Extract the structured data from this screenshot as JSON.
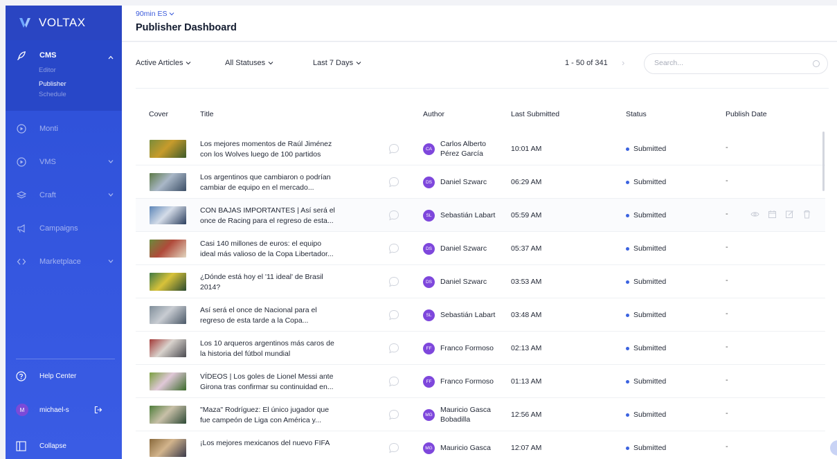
{
  "brand": {
    "name": "VOLTAX"
  },
  "sidebar": {
    "cms": {
      "label": "CMS",
      "items": [
        "Editor",
        "Publisher",
        "Schedule"
      ],
      "active": "Publisher"
    },
    "sections": [
      {
        "label": "Monti",
        "icon": "play-circle-icon"
      },
      {
        "label": "VMS",
        "icon": "play-circle-icon"
      },
      {
        "label": "Craft",
        "icon": "layers-icon"
      },
      {
        "label": "Campaigns",
        "icon": "megaphone-icon"
      },
      {
        "label": "Marketplace",
        "icon": "code-brackets-icon"
      }
    ],
    "help": "Help Center",
    "user": {
      "initial": "M",
      "name": "michael-s"
    },
    "collapse": "Collapse"
  },
  "header": {
    "site": "90min ES",
    "title": "Publisher Dashboard"
  },
  "filters": {
    "articles": "Active Articles",
    "statuses": "All Statuses",
    "range": "Last 7 Days",
    "pager": "1 - 50 of 341",
    "search_placeholder": "Search..."
  },
  "table": {
    "headers": {
      "cover": "Cover",
      "title": "Title",
      "author": "Author",
      "submitted": "Last Submitted",
      "status": "Status",
      "publish": "Publish Date"
    },
    "rows": [
      {
        "title1": "Los mejores momentos de Raúl Jiménez",
        "title2": "con los Wolves luego de 100 partidos",
        "initials": "CA",
        "author1": "Carlos Alberto",
        "author2": "Pérez García",
        "time": "10:01 AM",
        "status": "Submitted",
        "publish": "-"
      },
      {
        "title1": "Los argentinos que cambiaron o podrían",
        "title2": "cambiar de equipo en el mercado...",
        "initials": "DS",
        "author1": "Daniel Szwarc",
        "author2": "",
        "time": "06:29 AM",
        "status": "Submitted",
        "publish": "-"
      },
      {
        "title1": "CON BAJAS IMPORTANTES | Así será el",
        "title2": "once de Racing para el regreso de esta...",
        "initials": "SL",
        "author1": "Sebastián Labart",
        "author2": "",
        "time": "05:59 AM",
        "status": "Submitted",
        "publish": "-"
      },
      {
        "title1": "Casi 140 millones de euros: el equipo",
        "title2": "ideal más valioso de la Copa Libertador...",
        "initials": "DS",
        "author1": "Daniel Szwarc",
        "author2": "",
        "time": "05:37 AM",
        "status": "Submitted",
        "publish": "-"
      },
      {
        "title1": "¿Dónde está hoy el '11 ideal' de Brasil",
        "title2": "2014?",
        "initials": "DS",
        "author1": "Daniel Szwarc",
        "author2": "",
        "time": "03:53 AM",
        "status": "Submitted",
        "publish": "-"
      },
      {
        "title1": "Así será el once de Nacional para el",
        "title2": "regreso de esta tarde a la Copa...",
        "initials": "SL",
        "author1": "Sebastián Labart",
        "author2": "",
        "time": "03:48 AM",
        "status": "Submitted",
        "publish": "-"
      },
      {
        "title1": "Los 10 arqueros argentinos más caros de",
        "title2": "la historia del fútbol mundial",
        "initials": "FF",
        "author1": "Franco Formoso",
        "author2": "",
        "time": "02:13 AM",
        "status": "Submitted",
        "publish": "-"
      },
      {
        "title1": "VÍDEOS | Los goles de Lionel Messi ante",
        "title2": "Girona tras confirmar su continuidad en...",
        "initials": "FF",
        "author1": "Franco Formoso",
        "author2": "",
        "time": "01:13 AM",
        "status": "Submitted",
        "publish": "-"
      },
      {
        "title1": "\"Maza\" Rodríguez: El único jugador que",
        "title2": "fue campeón de Liga con América y...",
        "initials": "MG",
        "author1": "Mauricio Gasca",
        "author2": "Bobadilla",
        "time": "12:56 AM",
        "status": "Submitted",
        "publish": "-"
      },
      {
        "title1": "¡Los mejores mexicanos del nuevo FIFA",
        "title2": "",
        "initials": "MG",
        "author1": "Mauricio Gasca",
        "author2": "",
        "time": "12:07 AM",
        "status": "Submitted",
        "publish": "-"
      }
    ]
  },
  "colors": {
    "sidebar": "#3557e0",
    "accent": "#3b5bdb",
    "avatar": "#7e47dc",
    "status_dot": "#3b63e0"
  }
}
